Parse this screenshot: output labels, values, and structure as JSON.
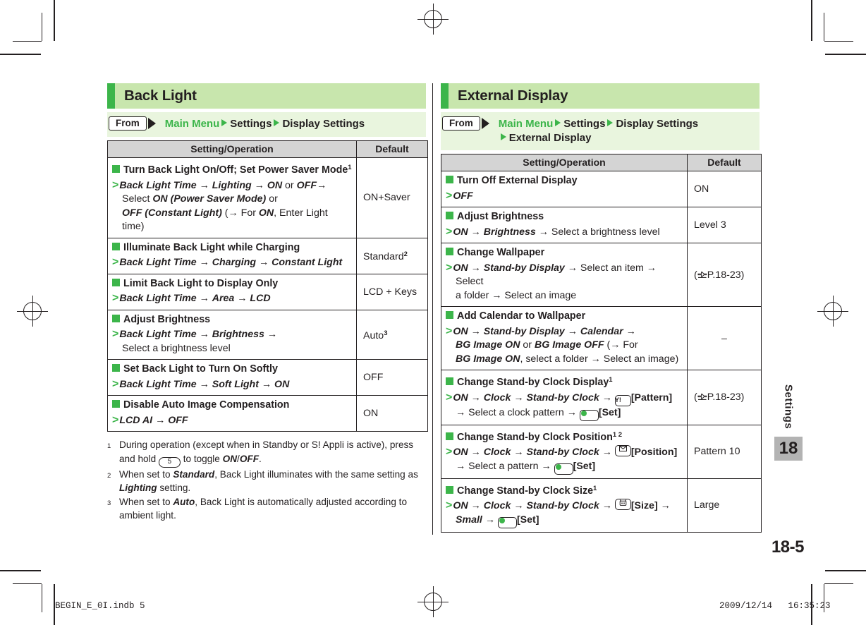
{
  "document": {
    "page_number": "18-5",
    "chapter_name": "Settings",
    "chapter_number": "18",
    "footer_file": "BEGIN_E_0I.indb     5",
    "footer_date": "2009/12/14",
    "footer_time": "16:35:23"
  },
  "colors": {
    "accent_green": "#3cb54a",
    "header_bg": "#c8e6ad",
    "from_bg": "#e9f5de",
    "table_header_bg": "#d4d4d4",
    "chapter_tab_bg": "#b3b3b3",
    "text": "#231f20"
  },
  "left_section": {
    "heading": "Back Light",
    "from_label": "From",
    "path": [
      "Main Menu",
      "Settings",
      "Display Settings"
    ],
    "table": {
      "headers": [
        "Setting/Operation",
        "Default"
      ],
      "rows": [
        {
          "title": "Turn Back Light On/Off; Set Power Saver Mode",
          "title_sup": "1",
          "default": "ON+Saver"
        },
        {
          "title": "Illuminate Back Light while Charging",
          "title_sup": "",
          "default": "Standard",
          "default_sup": "2"
        },
        {
          "title": "Limit Back Light to Display Only",
          "title_sup": "",
          "default": "LCD + Keys"
        },
        {
          "title": "Adjust Brightness",
          "title_sup": "",
          "default": "Auto",
          "default_sup": "3"
        },
        {
          "title": "Set Back Light to Turn On Softly",
          "title_sup": "",
          "default": "OFF"
        },
        {
          "title": "Disable Auto Image Compensation",
          "title_sup": "",
          "default": "ON"
        }
      ]
    },
    "footnotes": [
      {
        "num": "1",
        "text": "During operation (except when in Standby or S! Appli is active), press and hold [5] to toggle ON/OFF."
      },
      {
        "num": "2",
        "text": "When set to Standard, Back Light illuminates with the same setting as Lighting setting."
      },
      {
        "num": "3",
        "text": "When set to Auto, Back Light is automatically adjusted according to ambient light."
      }
    ]
  },
  "right_section": {
    "heading": "External Display",
    "from_label": "From",
    "path": [
      "Main Menu",
      "Settings",
      "Display Settings",
      "External Display"
    ],
    "table": {
      "headers": [
        "Setting/Operation",
        "Default"
      ],
      "rows": [
        {
          "title": "Turn Off External Display",
          "title_sup": "",
          "default": "ON"
        },
        {
          "title": "Adjust Brightness",
          "title_sup": "",
          "default": "Level 3"
        },
        {
          "title": "Change Wallpaper",
          "title_sup": "",
          "default": "(P.18-23)",
          "default_ref": "P.18-23"
        },
        {
          "title": "Add Calendar to Wallpaper",
          "title_sup": "",
          "default": "–"
        },
        {
          "title": "Change Stand-by Clock Display",
          "title_sup": "1",
          "default": "(P.18-23)",
          "default_ref": "P.18-23"
        },
        {
          "title": "Change Stand-by Clock Position",
          "title_sup": "1 2",
          "default": "Pattern 10"
        },
        {
          "title": "Change Stand-by Clock Size",
          "title_sup": "1",
          "default": "Large"
        }
      ]
    }
  },
  "icons": {
    "yahoo_key": "Y!",
    "mail_key": "envelope",
    "center_key": "green-dot",
    "tv_key": "tv",
    "page_ref": "pointing-hand",
    "key_5": "5"
  },
  "strings": {
    "select_brightness_level": "Select a brightness level",
    "select_item": "Select an item",
    "select_folder": "Select a folder",
    "select_image": "Select an image",
    "select_clock_pattern": "Select a clock pattern",
    "select_pattern": "Select a pattern",
    "for_word": "For",
    "or_word": "or",
    "select_word": "Select",
    "enter_light_time": "Enter Light time",
    "set_label": "[Set]",
    "pattern_label": "[Pattern]",
    "position_label": "[Position]",
    "size_label": "[Size]"
  }
}
